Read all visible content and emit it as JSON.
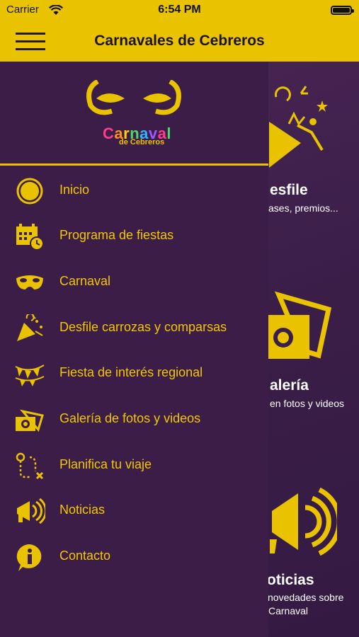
{
  "status": {
    "carrier": "Carrier",
    "time": "6:54 PM"
  },
  "header": {
    "title": "Carnavales de Cebreros"
  },
  "logo": {
    "word_letters": [
      "C",
      "a",
      "r",
      "n",
      "a",
      "v",
      "a",
      "l"
    ],
    "subtitle": "de Cebreros",
    "letter_colors": [
      "#ff3b8b",
      "#ff8f1f",
      "#ffd400",
      "#4cd964",
      "#2fb5ff",
      "#9b59ff",
      "#ff3b8b",
      "#4cd964"
    ]
  },
  "menu": [
    {
      "label": "Inicio",
      "icon": "circle-icon"
    },
    {
      "label": "Programa de fiestas",
      "icon": "calendar-clock-icon"
    },
    {
      "label": "Carnaval",
      "icon": "mask-icon"
    },
    {
      "label": "Desfile carrozas y comparsas",
      "icon": "party-popper-icon"
    },
    {
      "label": "Fiesta de interés regional",
      "icon": "bunting-icon"
    },
    {
      "label": "Galería de fotos y videos",
      "icon": "camera-icon"
    },
    {
      "label": "Planifica tu viaje",
      "icon": "route-icon"
    },
    {
      "label": "Noticias",
      "icon": "megaphone-icon"
    },
    {
      "label": "Contacto",
      "icon": "info-icon"
    }
  ],
  "cards": {
    "desfile": {
      "title": "esfile",
      "sub": "ases, premios..."
    },
    "galeria": {
      "title": "alería",
      "sub": "en fotos y videos"
    },
    "noticias": {
      "title": "oticias",
      "sub1": "novedades sobre",
      "sub2": "Carnaval"
    }
  },
  "colors": {
    "accent": "#e9c200",
    "drawer": "#3b1d48"
  }
}
